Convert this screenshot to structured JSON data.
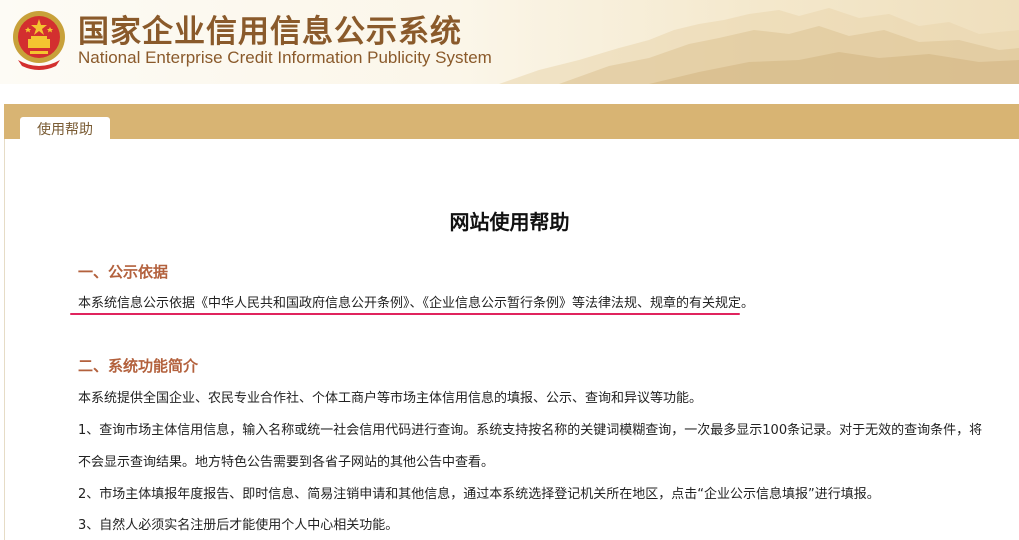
{
  "header": {
    "title_cn": "国家企业信用信息公示系统",
    "title_en": "National Enterprise Credit Information Publicity System",
    "emblem_icon": "national-emblem-icon",
    "accent_color": "#8a5a2b"
  },
  "tabs": [
    {
      "label": "使用帮助",
      "active": true
    }
  ],
  "main": {
    "title": "网站使用帮助",
    "sections": [
      {
        "heading": "一、公示依据",
        "paragraphs": [
          "本系统信息公示依据《中华人民共和国政府信息公开条例》、《企业信息公示暂行条例》等法律法规、规章的有关规定。"
        ]
      },
      {
        "heading": "二、系统功能简介",
        "paragraphs": [
          "本系统提供全国企业、农民专业合作社、个体工商户等市场主体信用信息的填报、公示、查询和异议等功能。",
          "1、查询市场主体信用信息，输入名称或统一社会信用代码进行查询。系统支持按名称的关键词模糊查询，一次最多显示100条记录。对于无效的查询条件，将",
          "不会显示查询结果。地方特色公告需要到各省子网站的其他公告中查看。",
          "2、市场主体填报年度报告、即时信息、简易注销申请和其他信息，通过本系统选择登记机关所在地区，点击“企业公示信息填报”进行填报。",
          "3、自然人必须实名注册后才能使用个人中心相关功能。"
        ]
      }
    ],
    "highlight_color": "#e0245e"
  }
}
